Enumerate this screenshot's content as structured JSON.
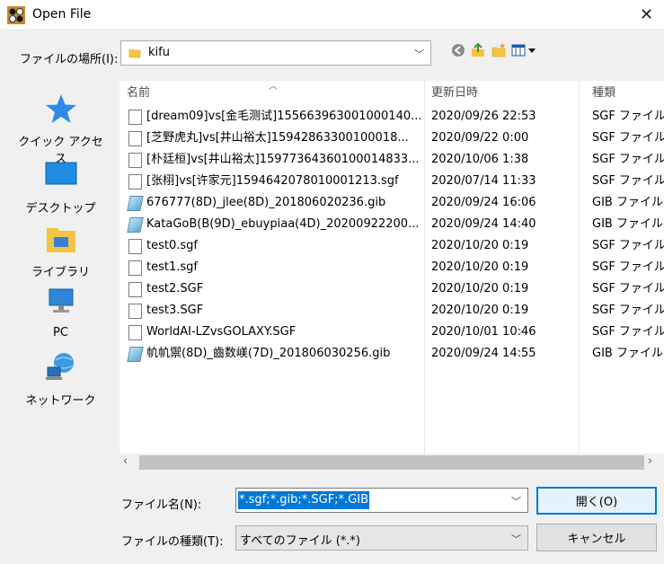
{
  "window": {
    "title": "Open File",
    "close_glyph": "✕"
  },
  "location": {
    "label": "ファイルの場所(I):",
    "value": "kifu",
    "toolbar_icons": [
      "back-icon",
      "up-folder-icon",
      "new-folder-icon",
      "view-menu-icon"
    ]
  },
  "places": [
    {
      "label": "クイック アクセス",
      "icon": "quick-access-star-icon"
    },
    {
      "label": "デスクトップ",
      "icon": "desktop-icon"
    },
    {
      "label": "ライブラリ",
      "icon": "library-icon"
    },
    {
      "label": "PC",
      "icon": "pc-icon"
    },
    {
      "label": "ネットワーク",
      "icon": "network-icon"
    }
  ],
  "columns": {
    "name": "名前",
    "date": "更新日時",
    "type": "種類"
  },
  "files": [
    {
      "name": "[dream09]vs[金毛测试]155663963001000140...",
      "date": "2020/09/26 22:53",
      "type": "SGF ファイル",
      "icon": "document-icon"
    },
    {
      "name": "[芝野虎丸]vs[井山裕太]15942863300100018...",
      "date": "2020/09/22 0:00",
      "type": "SGF ファイル",
      "icon": "document-icon"
    },
    {
      "name": "[朴廷桓]vs[井山裕太]15977364360100014833...",
      "date": "2020/10/06 1:38",
      "type": "SGF ファイル",
      "icon": "document-icon"
    },
    {
      "name": "[张栩]vs[许家元]1594642078010001213.sgf",
      "date": "2020/07/14 11:33",
      "type": "SGF ファイル",
      "icon": "document-icon"
    },
    {
      "name": "676777(8D)_jlee(8D)_201806020236.gib",
      "date": "2020/09/24 16:06",
      "type": "GIB ファイル",
      "icon": "gib-file-icon"
    },
    {
      "name": "KataGoB(B(9D)_ebuypiaa(4D)_20200922200...",
      "date": "2020/09/24 14:40",
      "type": "GIB ファイル",
      "icon": "gib-file-icon"
    },
    {
      "name": "test0.sgf",
      "date": "2020/10/20 0:19",
      "type": "SGF ファイル",
      "icon": "document-icon"
    },
    {
      "name": "test1.sgf",
      "date": "2020/10/20 0:19",
      "type": "SGF ファイル",
      "icon": "document-icon"
    },
    {
      "name": "test2.SGF",
      "date": "2020/10/20 0:19",
      "type": "SGF ファイル",
      "icon": "document-icon"
    },
    {
      "name": "test3.SGF",
      "date": "2020/10/20 0:19",
      "type": "SGF ファイル",
      "icon": "document-icon"
    },
    {
      "name": "WorldAI-LZvsGOLAXY.SGF",
      "date": "2020/10/01 10:46",
      "type": "SGF ファイル",
      "icon": "document-icon"
    },
    {
      "name": "㠶㠶禦(8D)_齒数嵄(7D)_201806030256.gib",
      "date": "2020/09/24 14:55",
      "type": "GIB ファイル",
      "icon": "gib-file-icon"
    }
  ],
  "filename": {
    "label": "ファイル名(N):",
    "value": "*.sgf;*.gib;*.SGF;*.GIB"
  },
  "filetype": {
    "label": "ファイルの種類(T):",
    "value": "すべてのファイル (*.*)"
  },
  "buttons": {
    "open": "開く(O)",
    "cancel": "キャンセル"
  },
  "colors": {
    "selection": "#0078d7",
    "accent_border": "#0078d7"
  }
}
